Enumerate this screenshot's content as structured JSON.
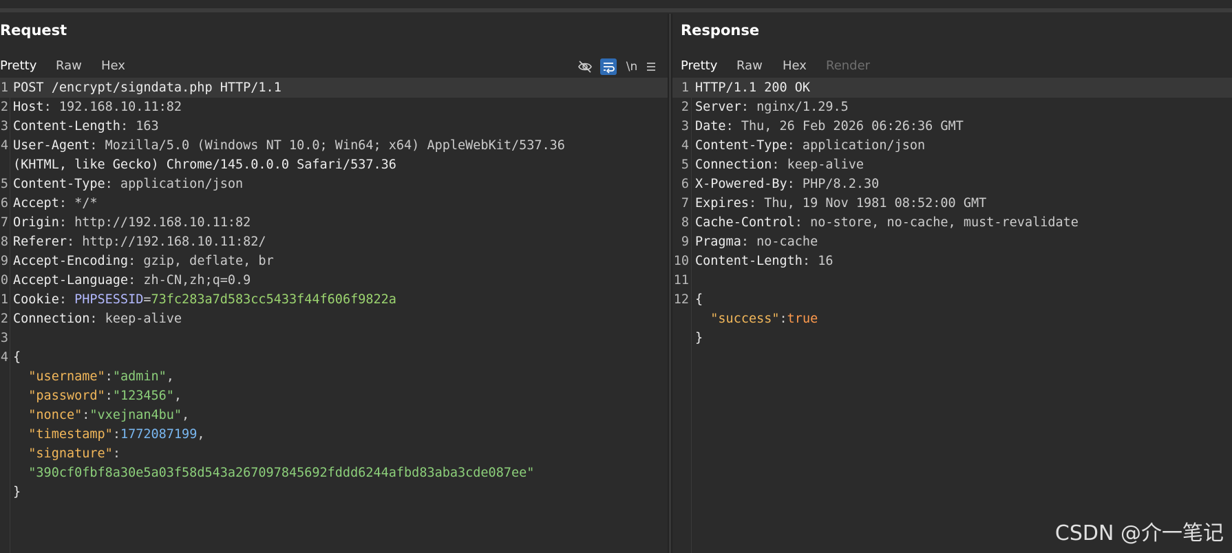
{
  "request": {
    "title": "Request",
    "tabs": [
      "Pretty",
      "Raw",
      "Hex"
    ],
    "tools": {
      "hide_icon": "eye-off-icon",
      "wrap_icon": "word-wrap-icon",
      "newline_label": "\\n",
      "menu_icon": "menu-icon"
    },
    "lines": [
      {
        "n": "1",
        "text": "POST /encrypt/signdata.php HTTP/1.1"
      },
      {
        "n": "2",
        "key": "Host",
        "val": " 192.168.10.11:82"
      },
      {
        "n": "3",
        "key": "Content-Length",
        "val": " 163"
      },
      {
        "n": "4",
        "key": "User-Agent",
        "val": " Mozilla/5.0 (Windows NT 10.0; Win64; x64) AppleWebKit/537.36"
      },
      {
        "n": "",
        "text": "(KHTML, like Gecko) Chrome/145.0.0.0 Safari/537.36"
      },
      {
        "n": "5",
        "key": "Content-Type",
        "val": " application/json"
      },
      {
        "n": "6",
        "key": "Accept",
        "val": " */*"
      },
      {
        "n": "7",
        "key": "Origin",
        "val": " http://192.168.10.11:82"
      },
      {
        "n": "8",
        "key": "Referer",
        "val": " http://192.168.10.11:82/"
      },
      {
        "n": "9",
        "key": "Accept-Encoding",
        "val": " gzip, deflate, br"
      },
      {
        "n": "0",
        "key": "Accept-Language",
        "val": " zh-CN,zh;q=0.9"
      },
      {
        "n": "1",
        "key": "Cookie",
        "val": " ",
        "cookie_name": "PHPSESSID",
        "cookie_val": "73fc283a7d583cc5433f44f606f9822a"
      },
      {
        "n": "2",
        "key": "Connection",
        "val": " keep-alive"
      },
      {
        "n": "3",
        "text": ""
      },
      {
        "n": "4",
        "text": "{"
      },
      {
        "n": "",
        "jkey": "\"username\"",
        "jval": "\"admin\"",
        "jtype": "str",
        "comma": ","
      },
      {
        "n": "",
        "jkey": "\"password\"",
        "jval": "\"123456\"",
        "jtype": "str",
        "comma": ","
      },
      {
        "n": "",
        "jkey": "\"nonce\"",
        "jval": "\"vxejnan4bu\"",
        "jtype": "str",
        "comma": ","
      },
      {
        "n": "",
        "jkey": "\"timestamp\"",
        "jval": "1772087199",
        "jtype": "num",
        "comma": ","
      },
      {
        "n": "",
        "jkey": "\"signature\"",
        "jval": "",
        "jtype": "str",
        "comma": ""
      },
      {
        "n": "",
        "jcont": "\"390cf0fbf8a30e5a03f58d543a267097845692fddd6244afbd83aba3cde087ee\""
      },
      {
        "n": "",
        "text": "}"
      }
    ]
  },
  "response": {
    "title": "Response",
    "tabs": [
      "Pretty",
      "Raw",
      "Hex",
      "Render"
    ],
    "lines": [
      {
        "n": "1",
        "text": "HTTP/1.1 200 OK"
      },
      {
        "n": "2",
        "key": "Server",
        "val": " nginx/1.29.5"
      },
      {
        "n": "3",
        "key": "Date",
        "val": " Thu, 26 Feb 2026 06:26:36 GMT"
      },
      {
        "n": "4",
        "key": "Content-Type",
        "val": " application/json"
      },
      {
        "n": "5",
        "key": "Connection",
        "val": " keep-alive"
      },
      {
        "n": "6",
        "key": "X-Powered-By",
        "val": " PHP/8.2.30"
      },
      {
        "n": "7",
        "key": "Expires",
        "val": " Thu, 19 Nov 1981 08:52:00 GMT"
      },
      {
        "n": "8",
        "key": "Cache-Control",
        "val": " no-store, no-cache, must-revalidate"
      },
      {
        "n": "9",
        "key": "Pragma",
        "val": " no-cache"
      },
      {
        "n": "10",
        "key": "Content-Length",
        "val": " 16"
      },
      {
        "n": "11",
        "text": ""
      },
      {
        "n": "12",
        "text": "{"
      },
      {
        "n": "",
        "jkey": "\"success\"",
        "jval": "true",
        "jtype": "bool",
        "comma": ""
      },
      {
        "n": "",
        "text": "}"
      }
    ]
  },
  "watermark": "CSDN @介一笔记"
}
